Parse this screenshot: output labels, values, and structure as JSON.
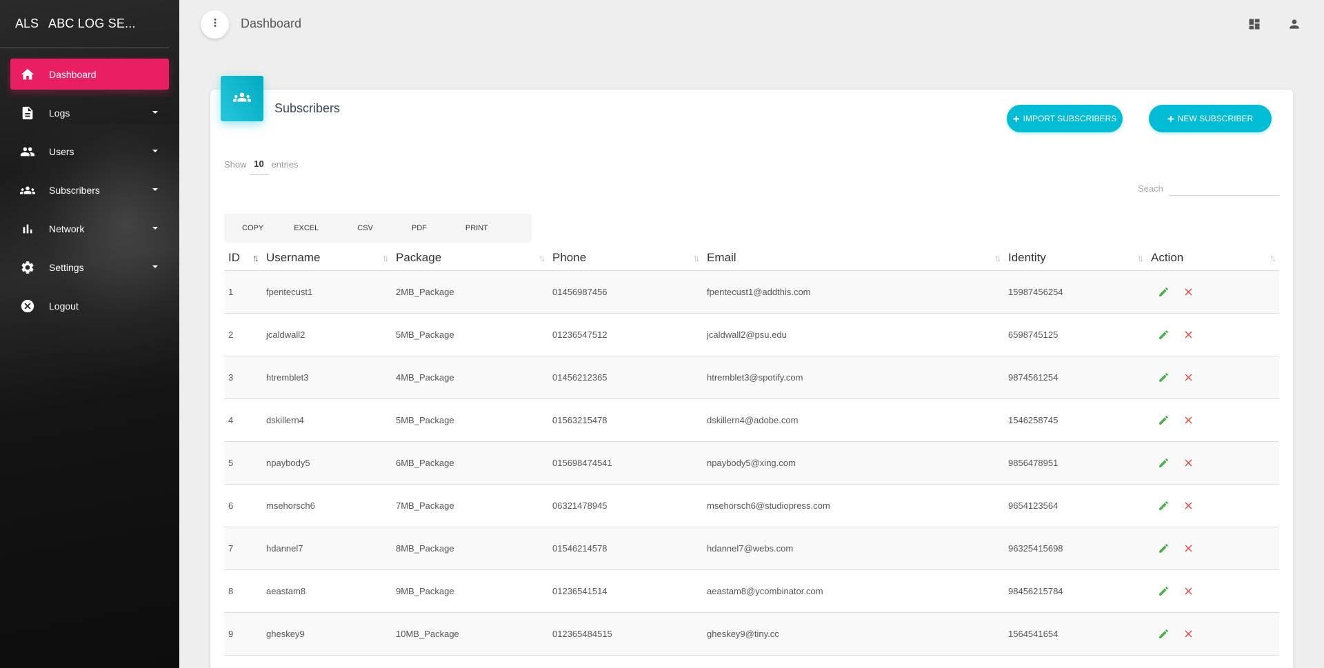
{
  "brand": {
    "mini": "ALS",
    "full": "ABC LOG SE..."
  },
  "sidebar": {
    "items": [
      {
        "label": "Dashboard"
      },
      {
        "label": "Logs"
      },
      {
        "label": "Users"
      },
      {
        "label": "Subscribers"
      },
      {
        "label": "Network"
      },
      {
        "label": "Settings"
      },
      {
        "label": "Logout"
      }
    ]
  },
  "topbar": {
    "title": "Dashboard"
  },
  "card": {
    "title": "Subscribers",
    "import_label": "IMPORT SUBSCRIBERS",
    "new_label": "NEW SUBSCRIBER",
    "show_prefix": "Show",
    "show_value": "10",
    "show_suffix": "entries",
    "search_label": "Seach",
    "export": [
      "COPY",
      "EXCEL",
      "CSV",
      "PDF",
      "PRINT"
    ]
  },
  "table": {
    "columns": [
      "ID",
      "Username",
      "Package",
      "Phone",
      "Email",
      "Identity",
      "Action"
    ],
    "rows": [
      [
        "1",
        "fpentecust1",
        "2MB_Package",
        "01456987456",
        "fpentecust1@addthis.com",
        "15987456254"
      ],
      [
        "2",
        "jcaldwall2",
        "5MB_Package",
        "01236547512",
        "jcaldwall2@psu.edu",
        "6598745125"
      ],
      [
        "3",
        "htremblet3",
        "4MB_Package",
        "01456212365",
        "htremblet3@spotify.com",
        "9874561254"
      ],
      [
        "4",
        "dskillern4",
        "5MB_Package",
        "01563215478",
        "dskillern4@adobe.com",
        "1546258745"
      ],
      [
        "5",
        "npaybody5",
        "6MB_Package",
        "015698474541",
        "npaybody5@xing.com",
        "9856478951"
      ],
      [
        "6",
        "msehorsch6",
        "7MB_Package",
        "06321478945",
        "msehorsch6@studiopress.com",
        "9654123564"
      ],
      [
        "7",
        "hdannel7",
        "8MB_Package",
        "01546214578",
        "hdannel7@webs.com",
        "96325415698"
      ],
      [
        "8",
        "aeastam8",
        "9MB_Package",
        "01236541514",
        "aeastam8@ycombinator.com",
        "98456215784"
      ],
      [
        "9",
        "gheskey9",
        "10MB_Package",
        "012365484515",
        "gheskey9@tiny.cc",
        "1564541654"
      ]
    ]
  },
  "colors": {
    "accent": "#e91e63",
    "primary": "#00bcd4",
    "edit": "#4caf50",
    "delete": "#f44336"
  },
  "icons": [
    "home-icon",
    "document-icon",
    "people-icon",
    "group-icon",
    "bar-chart-icon",
    "gear-icon",
    "close-circle-icon",
    "more-vert-icon",
    "dashboard-grid-icon",
    "person-icon",
    "edit-icon",
    "delete-icon"
  ]
}
